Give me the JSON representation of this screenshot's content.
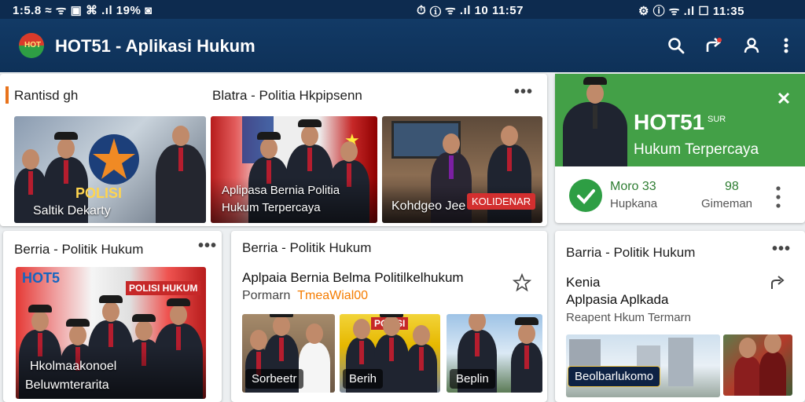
{
  "status_bar": {
    "left": "1:5.8  ≈  ᯤ  ▣  ⌘  .ıl  19%  ◙",
    "center": "⏱  ⓘ  ᯤ .ıl 10  11:57",
    "right": "⚙  ⓘ  ᯤ .ıl  ☐  11:35"
  },
  "app_bar": {
    "title": "HOT51 - Aplikasi Hukum",
    "logo_text": "HOT",
    "icons": [
      "search-icon",
      "share-icon",
      "person-icon",
      "more-vert-icon"
    ]
  },
  "section_top": {
    "label": "Rantisd gh",
    "center_label": "Blatra - Politia Hkpipsenn",
    "accent": "#e8731c",
    "thumbs": [
      {
        "caption": "Saltik Dekarty",
        "overlay": "POLISI"
      },
      {
        "caption_line1": "Aplipasa Bernia Politia",
        "caption_line2": "Hukum Terpercaya"
      },
      {
        "caption": "Kohdgeo Jee",
        "badge": "KOLIDENAR"
      }
    ]
  },
  "promo_card": {
    "title": "HOT51",
    "title_suffix": "SUR",
    "subtitle": "Hukum Terpercaya",
    "close_icon": "close-icon",
    "stat1_value": "Moro 33",
    "stat1_label": "Hupkana",
    "stat2_value": "98",
    "stat2_label": "Gimeman",
    "bg": "#43a047"
  },
  "card_left": {
    "header": "Berria - Politik Hukum",
    "image_title": "HOT5",
    "image_banner": "POLISI HUKUM",
    "caption_line1": "Hkolmaakonoel",
    "caption_line2": "Beluwmterarita"
  },
  "card_mid": {
    "header": "Berria - Politik Hukum",
    "headline": "Aplpaia Bernia Belma Politilkelhukum",
    "sub_prefix": "Pormarn",
    "sub_highlight": "TmeaWial00",
    "thumbs": [
      {
        "caption": "Sorbeetr"
      },
      {
        "caption": "Berih",
        "banner": "POLISI"
      },
      {
        "caption": "Beplin"
      }
    ]
  },
  "card_right": {
    "header": "Barria - Politik Hukum",
    "title_line1": "Kenia",
    "title_line2": "Aplpasia Aplkada",
    "subtitle": "Reapent Hkum Termarn",
    "pill": "Beolbarlukomo"
  }
}
